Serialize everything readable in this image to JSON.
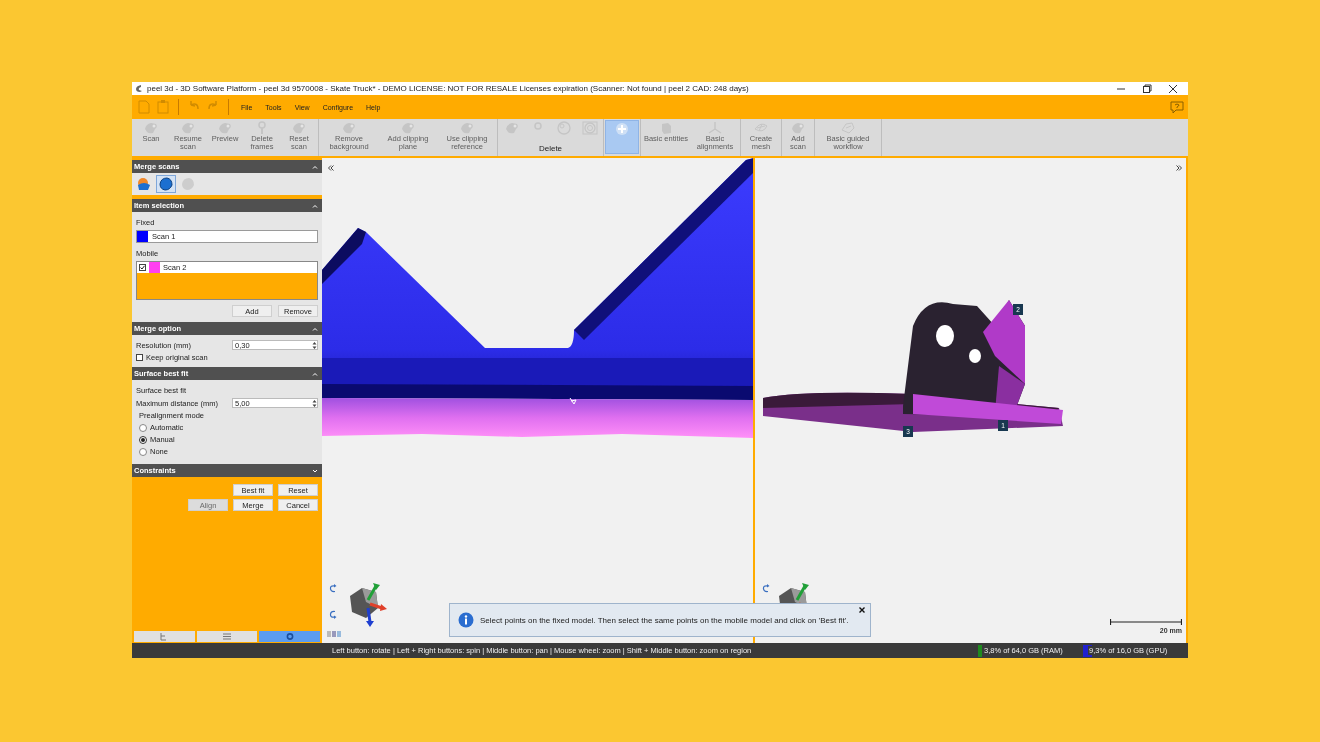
{
  "window": {
    "title": "peel 3d - 3D Software Platform - peel 3d 9570008 - Skate Truck* - DEMO LICENSE: NOT FOR RESALE Licenses expiration (Scanner: Not found | peel 2 CAD: 248 days)"
  },
  "menu": [
    "File",
    "Tools",
    "View",
    "Configure",
    "Help"
  ],
  "toolbar": {
    "groups": [
      {
        "items": [
          {
            "label": "Scan",
            "disabled": true,
            "selected": false
          },
          {
            "label": "Resume scan",
            "disabled": true,
            "selected": false
          },
          {
            "label": "Preview",
            "disabled": true,
            "selected": false
          },
          {
            "label": "Delete frames",
            "disabled": true,
            "selected": false
          },
          {
            "label": "Reset scan",
            "disabled": true,
            "selected": false
          }
        ]
      },
      {
        "items": [
          {
            "label": "Remove background",
            "disabled": true,
            "selected": false
          },
          {
            "label": "Add clipping plane",
            "disabled": true,
            "selected": false
          },
          {
            "label": "Use clipping reference",
            "disabled": true,
            "selected": false
          }
        ]
      },
      {
        "label": "Delete",
        "items": [
          {
            "disabled": true,
            "selected": false
          },
          {
            "disabled": true,
            "selected": false
          },
          {
            "disabled": true,
            "selected": false
          },
          {
            "disabled": true,
            "selected": false
          }
        ]
      },
      {
        "items": [
          {
            "disabled": false,
            "selected": true
          }
        ]
      },
      {
        "items": [
          {
            "label": "Basic entities",
            "disabled": true,
            "selected": false
          },
          {
            "label": "Basic alignments",
            "disabled": true,
            "selected": false
          }
        ]
      },
      {
        "items": [
          {
            "label": "Create mesh",
            "disabled": true,
            "selected": false
          }
        ]
      },
      {
        "items": [
          {
            "label": "Add scan",
            "disabled": true,
            "selected": false
          }
        ]
      },
      {
        "items": [
          {
            "label": "Basic guided workflow",
            "disabled": true,
            "selected": false
          }
        ]
      }
    ]
  },
  "panel": {
    "sections": [
      {
        "kind": "modes",
        "title": "Merge scans",
        "expanded": true,
        "modes": [
          {
            "selected": false,
            "disabled": false
          },
          {
            "selected": true,
            "disabled": false
          },
          {
            "selected": false,
            "disabled": true
          }
        ]
      },
      {
        "kind": "items",
        "title": "Item selection",
        "expanded": true,
        "fixed_label": "Fixed",
        "fixed": {
          "name": "Scan 1",
          "color": "#0000ff"
        },
        "mobile_label": "Mobile",
        "mobile": [
          {
            "name": "Scan 2",
            "color": "#ff40f0",
            "checked": true
          }
        ],
        "buttons": [
          "Add",
          "Remove"
        ]
      },
      {
        "kind": "merge",
        "title": "Merge option",
        "expanded": true,
        "fields": [
          {
            "label": "Resolution (mm)",
            "value": "0,30"
          }
        ],
        "checkboxes": [
          {
            "label": "Keep original scan",
            "checked": false
          }
        ]
      },
      {
        "kind": "fit",
        "title": "Surface best fit",
        "expanded": true,
        "subtitle": "Surface best fit",
        "fields": [
          {
            "label": "Maximum distance (mm)",
            "value": "5,00"
          }
        ],
        "radio_label": "Prealignment mode",
        "radios": [
          {
            "label": "Automatic",
            "selected": false
          },
          {
            "label": "Manual",
            "selected": true
          },
          {
            "label": "None",
            "selected": false
          }
        ]
      },
      {
        "kind": "constraints",
        "title": "Constraints",
        "expanded": false
      }
    ],
    "buttons": [
      {
        "label": "Best fit",
        "disabled": false
      },
      {
        "label": "Reset",
        "disabled": false
      },
      {
        "label": "Align",
        "disabled": true
      },
      {
        "label": "Merge",
        "disabled": false
      },
      {
        "label": "Cancel",
        "disabled": false
      }
    ],
    "bottom_tabs": [
      {
        "selected": false
      },
      {
        "selected": false
      },
      {
        "selected": true
      }
    ]
  },
  "viewports": [
    {
      "kind": "fixed"
    },
    {
      "kind": "mobile",
      "markers": [
        "2",
        "1",
        "3"
      ],
      "scale": "20 mm"
    }
  ],
  "notice": {
    "text": "Select points on the fixed model. Then select the same points on the mobile model and click on 'Best fit'."
  },
  "status_bar": {
    "hint": "Left button: rotate | Left + Right buttons: spin | Middle button: pan | Mouse wheel: zoom | Shift + Middle button: zoom on region",
    "meters": [
      {
        "text": "3,8% of 64,0 GB (RAM)",
        "level": 0.038,
        "color": "#1f8a1f"
      },
      {
        "text": "9,3% of 16,0 GB (GPU)",
        "level": 0.093,
        "color": "#2020d0"
      }
    ]
  }
}
